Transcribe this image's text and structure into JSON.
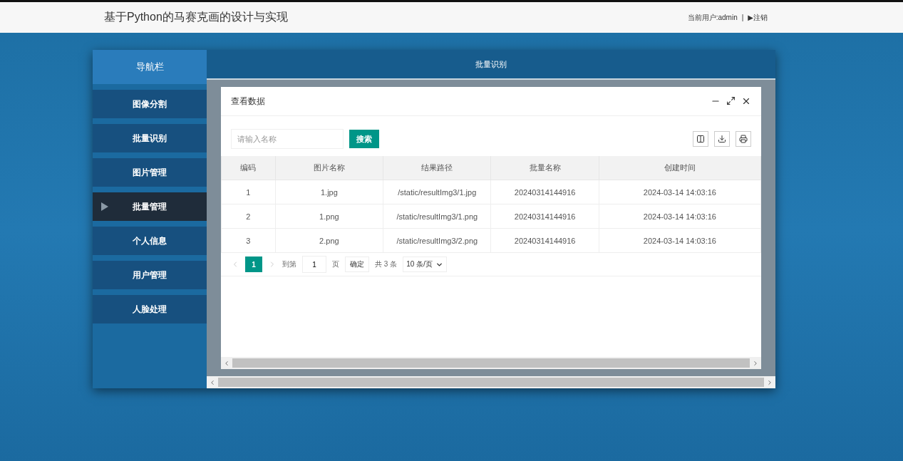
{
  "header": {
    "title": "基于Python的马赛克画的设计与实现",
    "user": "当前用户:admin",
    "separator": "|",
    "logout": "▶注销"
  },
  "sidebar": {
    "title": "导航栏",
    "items": [
      {
        "label": "图像分割",
        "selected": false
      },
      {
        "label": "批量识别",
        "selected": false
      },
      {
        "label": "图片管理",
        "selected": false
      },
      {
        "label": "批量管理",
        "selected": true
      },
      {
        "label": "个人信息",
        "selected": false
      },
      {
        "label": "用户管理",
        "selected": false
      },
      {
        "label": "人脸处理",
        "selected": false
      }
    ]
  },
  "content": {
    "title": "批量识别"
  },
  "dialog": {
    "title": "查看数据",
    "search": {
      "placeholder": "请输入名称",
      "button": "搜索"
    },
    "table": {
      "columns": [
        "编码",
        "图片名称",
        "结果路径",
        "批量名称",
        "创建时间"
      ],
      "rows": [
        [
          "1",
          "1.jpg",
          "/static/resultImg3/1.jpg",
          "20240314144916",
          "2024-03-14 14:03:16"
        ],
        [
          "2",
          "1.png",
          "/static/resultImg3/1.png",
          "20240314144916",
          "2024-03-14 14:03:16"
        ],
        [
          "3",
          "2.png",
          "/static/resultImg3/2.png",
          "20240314144916",
          "2024-03-14 14:03:16"
        ]
      ]
    },
    "pagination": {
      "pages": [
        {
          "label": "1",
          "selected": true
        }
      ],
      "goto_label": "到第",
      "page_value": "1",
      "page_unit": "页",
      "confirm": "确定",
      "total": "共 3 条",
      "page_size": "10 条/页"
    }
  }
}
